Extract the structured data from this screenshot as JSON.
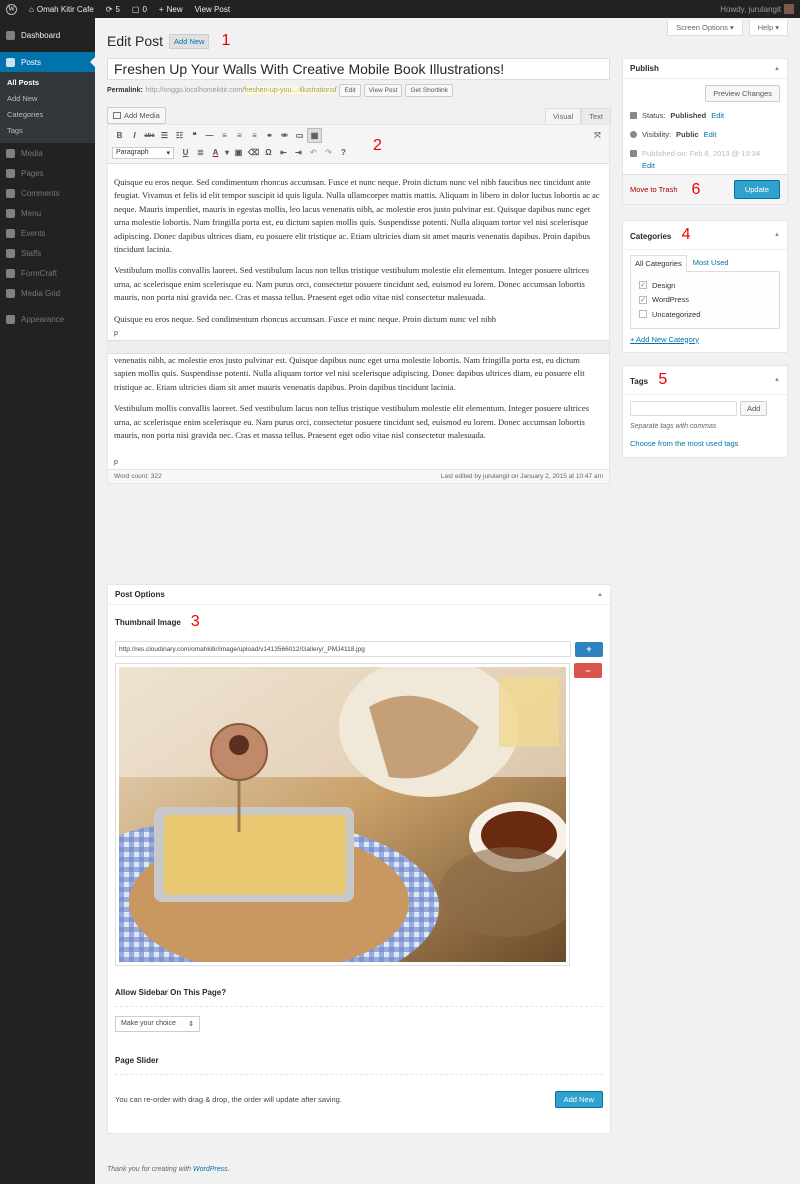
{
  "adminbar": {
    "site_name": "Omah Kitir Cafe",
    "updates_count": "5",
    "comments_count": "0",
    "new_label": "New",
    "view_post_label": "View Post",
    "howdy": "Howdy, jurulangit"
  },
  "sidebar": {
    "dashboard": "Dashboard",
    "posts": "Posts",
    "submenu": [
      "All Posts",
      "Add New",
      "Categories",
      "Tags"
    ],
    "items": [
      "Media",
      "Pages",
      "Comments",
      "Menu",
      "Events",
      "Staffs",
      "FormCraft",
      "Media Grid",
      "Appearance"
    ]
  },
  "screen_tabs": {
    "screen_options": "Screen Options ▾",
    "help": "Help ▾"
  },
  "page": {
    "title": "Edit Post",
    "add_new": "Add New",
    "annotations": [
      "1",
      "2",
      "3",
      "4",
      "5",
      "6"
    ]
  },
  "post": {
    "title": "Freshen Up Your Walls With Creative Mobile Book Illustrations!",
    "permalink_label": "Permalink:",
    "permalink_base": "http://onggo.localhomekitir.com/",
    "permalink_slug": "freshen-up-you...-illustrations",
    "permalink_tail": "/",
    "edit_btn": "Edit",
    "view_post_btn": "View Post",
    "shortlink_btn": "Get Shortlink"
  },
  "editor": {
    "add_media": "Add Media",
    "tab_visual": "Visual",
    "tab_text": "Text",
    "format_select": "Paragraph",
    "paragraphs_top": [
      "Quisque eu eros neque. Sed condimentum rhoncus accumsan. Fusce et nunc neque. Proin dictum nunc vel nibh faucibus nec tincidunt ante feugiat. Vivamus et felis id elit tempor suscipit id quis ligula. Nulla ullamcorper mattis mattis. Aliquam in libero in dolor luctus lobortis ac ac neque. Mauris imperdiet, mauris in egestas mollis, leo lacus venenatis nibh, ac molestie eros justo pulvinar est. Quisque dapibus nunc eget urna molestie lobortis. Nam fringilla porta est, eu dictum sapien mollis quis. Suspendisse potenti. Nulla aliquam tortor vel nisi scelerisque adipiscing. Donec dapibus ultrices diam, eu posuere elit tristique ac. Etiam ultricies diam sit amet mauris venenatis dapibus. Proin dapibus tincidunt lacinia.",
      "Vestibulum mollis convallis laoreet. Sed vestibulum lacus non tellus tristique vestibulum molestie elit elementum. Integer posuere ultrices urna, ac scelerisque enim scelerisque eu. Nam purus orci, consectetur posuere tincidunt sed, euismod eu lorem. Donec accumsan lobortis mauris, non porta nisi gravida nec. Cras et massa tellus. Praesent eget odio vitae nisl consectetur malesuada.",
      "Quisque eu eros neque. Sed condimentum rhoncus accumsan. Fusce et nunc neque. Proin dictum nunc vel nibh"
    ],
    "p_tag": "p",
    "paragraphs_bottom": [
      "venenatis nibh, ac molestie eros justo pulvinar est. Quisque dapibus nunc eget urna molestie lobortis. Nam fringilla porta est, eu dictum sapien mollis quis. Suspendisse potenti. Nulla aliquam tortor vel nisi scelerisque adipiscing. Donec dapibus ultrices diam, eu posuere elit tristique ac. Etiam ultricies diam sit amet mauris venenatis dapibus. Proin dapibus tincidunt lacinia.",
      "Vestibulum mollis convallis laoreet. Sed vestibulum lacus non tellus tristique vestibulum molestie elit elementum. Integer posuere ultrices urna, ac scelerisque enim scelerisque eu. Nam purus orci, consectetur posuere tincidunt sed, euismod eu lorem. Donec accumsan lobortis mauris, non porta nisi gravida nec. Cras et massa tellus. Praesent eget odio vitae nisl consectetur malesuada."
    ],
    "word_count": "Word count: 322",
    "last_edited": "Last edited by jurulangit on January 2, 2015 at 10:47 am"
  },
  "post_options": {
    "heading": "Post Options",
    "thumbnail_label": "Thumbnail Image",
    "thumbnail_url": "http://res.cloudinary.com/omahkitir/image/upload/v1413566012/Gallery/_PMJ4118.jpg",
    "add_icon": "+",
    "remove_icon": "−",
    "sidebar_label": "Allow Sidebar On This Page?",
    "sidebar_select": "Make your choice",
    "slider_label": "Page Slider",
    "slider_help": "You can re-order with drag & drop, the order will update after saving.",
    "slider_add": "Add New"
  },
  "publish": {
    "heading": "Publish",
    "preview": "Preview Changes",
    "status_label": "Status:",
    "status_value": "Published",
    "visibility_label": "Visibility:",
    "visibility_value": "Public",
    "published_on": "Published on: Feb 8, 2013 @ 19:34",
    "edit": "Edit",
    "trash": "Move to Trash",
    "update": "Update"
  },
  "categories": {
    "heading": "Categories",
    "tab_all": "All Categories",
    "tab_used": "Most Used",
    "items": [
      {
        "label": "Design",
        "checked": "✓"
      },
      {
        "label": "WordPress",
        "checked": "✓"
      },
      {
        "label": "Uncategorized",
        "checked": ""
      }
    ],
    "add_new": "+ Add New Category"
  },
  "tags": {
    "heading": "Tags",
    "add": "Add",
    "help": "Separate tags with commas",
    "choose": "Choose from the most used tags"
  },
  "footer": {
    "thanks": "Thank you for creating with ",
    "wp": "WordPress",
    "dot": "."
  },
  "colors": {
    "accent": "#0073aa",
    "update_btn": "#2ea2cc",
    "remove_btn": "#d9534f",
    "add_btn": "#2b84c0",
    "annotation": "#e00000"
  }
}
